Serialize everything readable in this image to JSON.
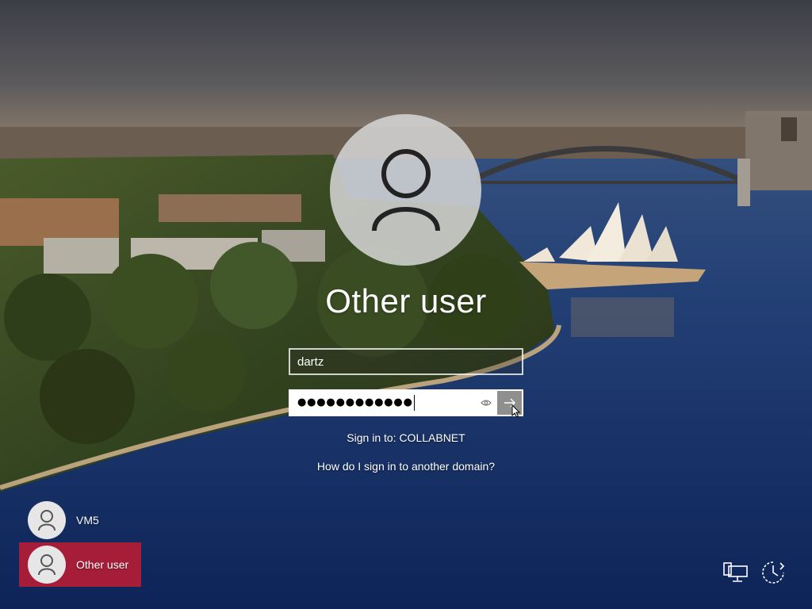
{
  "login": {
    "title": "Other user",
    "username_value": "dartz",
    "password_mask": "●●●●●●●●●●●●",
    "signin_to": "Sign in to: COLLABNET",
    "help_link": "How do I sign in to another domain?"
  },
  "user_tiles": [
    {
      "name": "VM5",
      "selected": false
    },
    {
      "name": "Other user",
      "selected": true
    }
  ],
  "colors": {
    "selected_tile": "#a51d38",
    "submit_button": "#8f8f8f"
  },
  "icons": {
    "avatar": "person-icon",
    "reveal": "eye-icon",
    "submit": "arrow-right-icon",
    "network": "network-icon",
    "power": "power-icon"
  }
}
